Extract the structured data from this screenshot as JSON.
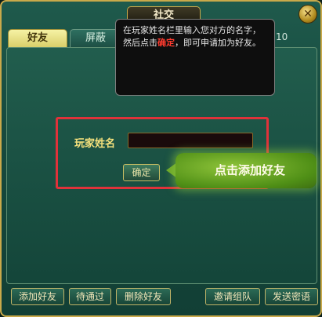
{
  "window": {
    "title": "社交",
    "close_icon": "close-icon"
  },
  "tabs": [
    {
      "label": "好友",
      "active": true
    },
    {
      "label": "屏蔽",
      "active": false
    }
  ],
  "tab_count": "10",
  "tooltip": {
    "text_before": "在玩家姓名栏里输入您对方的名字，然后点击",
    "highlight": "确定",
    "text_after": "，即可申请加为好友。"
  },
  "form": {
    "name_label": "玩家姓名",
    "name_value": "",
    "ok_button": "确定"
  },
  "hint": {
    "text": "点击添加好友"
  },
  "bottom_buttons": {
    "add_friend": "添加好友",
    "pending": "待通过",
    "delete_friend": "删除好友",
    "invite_team": "邀请组队",
    "send_whisper": "发送密语"
  },
  "colors": {
    "accent_red": "#e0323a",
    "gold": "#c9a94a",
    "hint_green": "#6da82a"
  }
}
